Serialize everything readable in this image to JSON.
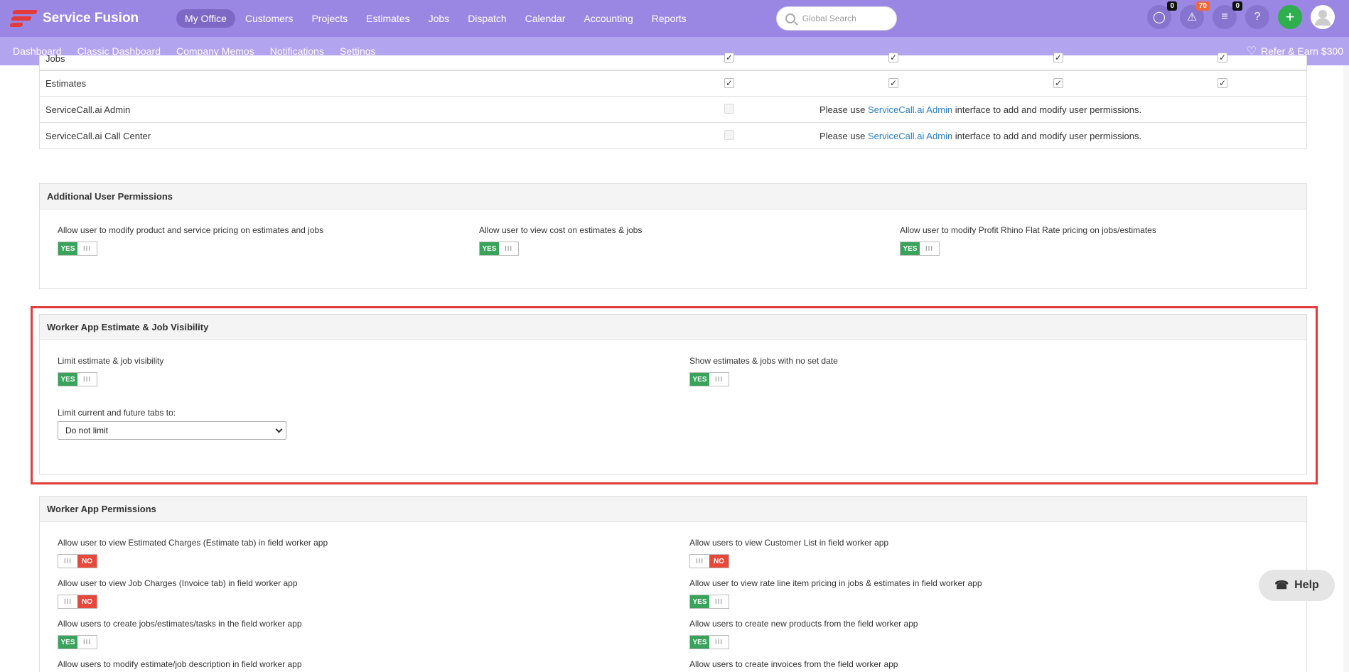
{
  "app": {
    "brand": "Service Fusion",
    "nav": [
      {
        "label": "My Office",
        "active": true
      },
      {
        "label": "Customers"
      },
      {
        "label": "Projects"
      },
      {
        "label": "Estimates"
      },
      {
        "label": "Jobs"
      },
      {
        "label": "Dispatch"
      },
      {
        "label": "Calendar"
      },
      {
        "label": "Accounting"
      },
      {
        "label": "Reports"
      }
    ],
    "search_placeholder": "Global Search",
    "badges": {
      "messages": "0",
      "notifications": "70",
      "tasks": "0"
    },
    "help_glyph": "?",
    "add_glyph": "+"
  },
  "subnav": {
    "items": [
      "Dashboard",
      "Classic Dashboard",
      "Company Memos",
      "Notifications",
      "Settings"
    ],
    "refer": "Refer & Earn $300"
  },
  "permissions_table": {
    "rows": [
      {
        "name": "Jobs",
        "checks": [
          true,
          true,
          true,
          true
        ]
      },
      {
        "name": "Estimates",
        "checks": [
          true,
          true,
          true,
          true
        ]
      },
      {
        "name": "ServiceCall.ai Admin",
        "note_pre": "Please use ",
        "note_link": "ServiceCall.ai Admin",
        "note_post": " interface to add and modify user permissions."
      },
      {
        "name": "ServiceCall.ai Call Center",
        "note_pre": "Please use ",
        "note_link": "ServiceCall.ai Admin",
        "note_post": " interface to add and modify user permissions."
      }
    ]
  },
  "additional": {
    "title": "Additional User Permissions",
    "items": [
      {
        "label": "Allow user to modify product and service pricing on estimates and jobs",
        "value": "YES"
      },
      {
        "label": "Allow user to view cost on estimates & jobs",
        "value": "YES"
      },
      {
        "label": "Allow user to modify Profit Rhino Flat Rate pricing on jobs/estimates",
        "value": "YES"
      }
    ]
  },
  "visibility": {
    "title": "Worker App Estimate & Job Visibility",
    "limit_label": "Limit estimate & job visibility",
    "limit_value": "YES",
    "no_date_label": "Show estimates & jobs with no set date",
    "no_date_value": "YES",
    "tabs_label": "Limit current and future tabs to:",
    "tabs_value": "Do not limit"
  },
  "worker": {
    "title": "Worker App Permissions",
    "left": [
      {
        "label": "Allow user to view Estimated Charges (Estimate tab) in field worker app",
        "value": "NO"
      },
      {
        "label": "Allow user to view Job Charges (Invoice tab) in field worker app",
        "value": "NO"
      },
      {
        "label": "Allow users to create jobs/estimates/tasks in the field worker app",
        "value": "YES"
      },
      {
        "label": "Allow users to modify estimate/job description in field worker app"
      }
    ],
    "right": [
      {
        "label": "Allow users to view Customer List in field worker app",
        "value": "NO"
      },
      {
        "label": "Allow user to view rate line item pricing in jobs & estimates in field worker app",
        "value": "YES"
      },
      {
        "label": "Allow users to create new products from the field worker app",
        "value": "YES"
      },
      {
        "label": "Allow users to create invoices from the field worker app"
      }
    ]
  },
  "help": {
    "label": "Help"
  },
  "toggle_grip": "III"
}
